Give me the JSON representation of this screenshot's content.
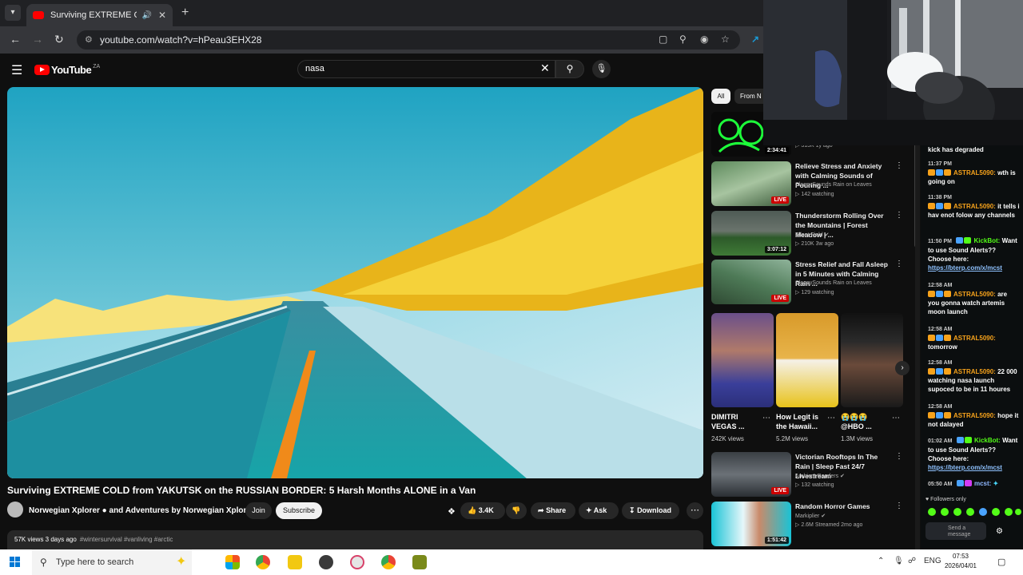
{
  "browser": {
    "tab_title": "Surviving EXTREME COLD fr",
    "new_tab": "+",
    "url": "youtube.com/watch?v=hPeau3EHX28"
  },
  "youtube": {
    "logo_text": "YouTube",
    "logo_country": "ZA",
    "search_value": "nasa"
  },
  "video": {
    "title": "Surviving EXTREME COLD from YAKUTSK on the RUSSIAN BORDER: 5 Harsh Months ALONE in a Van",
    "channel": "Norwegian Xplorer ● and Adventures by Norwegian Xplorer",
    "join": "Join",
    "subscribe": "Subscribe",
    "likes": "3.4K",
    "share": "Share",
    "ask": "Ask",
    "download": "Download",
    "views_date": "57K views  3 days ago",
    "tags": "#wintersurvival #vanliving #arctic"
  },
  "sidebar": {
    "chips": [
      "All",
      "From N"
    ],
    "related": [
      {
        "title": "",
        "channel": "",
        "meta": "▷ 313K  1y ago",
        "badge": "2:34:41",
        "live": false
      },
      {
        "title": "Relieve Stress and Anxiety with Calming Sounds of Pouring ...",
        "channel": "SleepySounds Rain on Leaves",
        "meta": "▷ 142 watching",
        "badge": "LIVE",
        "live": true
      },
      {
        "title": "Thunderstorm Rolling Over the Mountains | Forest Meadow | ...",
        "channel": "Silent Field ✔",
        "meta": "▷ 210K  3w ago",
        "badge": "3:07:12",
        "live": false
      },
      {
        "title": "Stress Relief and Fall Asleep in 5 Minutes with Calming Rain ...",
        "channel": "SleepySounds Rain on Leaves",
        "meta": "▷ 129 watching",
        "badge": "LIVE",
        "live": true
      },
      {
        "title": "Victorian Rooftops In The Rain | Sleep Fast 24/7 Livestream",
        "channel": "Ambient Renders ✔",
        "meta": "▷ 132 watching",
        "badge": "LIVE",
        "live": true
      },
      {
        "title": "Random Horror Games",
        "channel": "Markiplier ✔",
        "meta": "▷ 2.6M  Streamed 2mo ago",
        "badge": "1:51:42",
        "live": false
      }
    ],
    "shorts": [
      {
        "title": "DIMITRI VEGAS ...",
        "views": "242K views"
      },
      {
        "title": "How Legit is the Hawaii...",
        "views": "5.2M views"
      },
      {
        "title": "😭😭😭 @HBO ...",
        "views": "1.3M views"
      }
    ]
  },
  "chat": {
    "messages": [
      {
        "time": "",
        "user": "",
        "text": "kick has degraded",
        "cls": ""
      },
      {
        "time": "11:37 PM",
        "user": "ASTRAL5090:",
        "text": "wth is going on",
        "cls": ""
      },
      {
        "time": "11:38 PM",
        "user": "ASTRAL5090:",
        "text": "it tells i hav enot folow any channels",
        "cls": ""
      },
      {
        "time": "11:50 PM",
        "user": "KickBot:",
        "text": "Want to use Sound Alerts?? Choose here:",
        "link": "https://bterp.com/x/mcst",
        "cls": "g"
      },
      {
        "time": "12:58 AM",
        "user": "ASTRAL5090:",
        "text": "are you gonna watch artemis moon launch",
        "cls": ""
      },
      {
        "time": "12:58 AM",
        "user": "ASTRAL5090:",
        "text": "tomorrow",
        "cls": ""
      },
      {
        "time": "12:58 AM",
        "user": "ASTRAL5090:",
        "text": "22 000 watching nasa launch supoced to be in 11 houres",
        "cls": ""
      },
      {
        "time": "12:58 AM",
        "user": "ASTRAL5090:",
        "text": "hope it not dalayed",
        "cls": ""
      },
      {
        "time": "01:02 AM",
        "user": "KickBot:",
        "text": "Want to use Sound Alerts?? Choose here:",
        "link": "https://bterp.com/x/mcst",
        "cls": "g"
      },
      {
        "time": "05:50 AM",
        "user": "mcst:",
        "text": "",
        "cls": "b"
      }
    ],
    "followers_only": "Followers only",
    "send_placeholder": "Send a message"
  },
  "taskbar": {
    "search_placeholder": "Type here to search",
    "language": "ENG",
    "time": "07:53",
    "date": "2026/04/01"
  }
}
